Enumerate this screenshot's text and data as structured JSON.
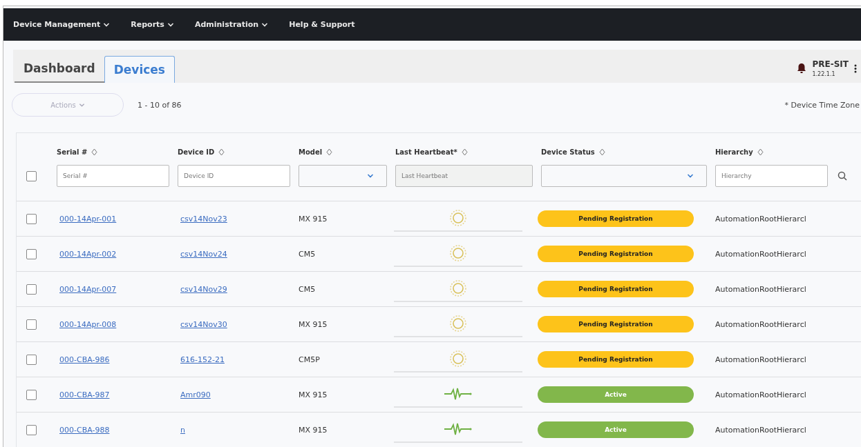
{
  "nav": [
    {
      "label": "Device Management",
      "dropdown": true
    },
    {
      "label": "Reports",
      "dropdown": true
    },
    {
      "label": "Administration",
      "dropdown": true
    },
    {
      "label": "Help & Support",
      "dropdown": false
    }
  ],
  "tabs": [
    {
      "label": "Dashboard",
      "selected": false
    },
    {
      "label": "Devices",
      "selected": true
    }
  ],
  "environment": {
    "name": "PRE-SIT",
    "version": "1.22.1.1"
  },
  "toolbar": {
    "actions": {
      "label": "Actions",
      "disabled": true
    },
    "range": "1 - 10 of 86",
    "note": "* Device Time Zone"
  },
  "table": {
    "select_all": {
      "checked": false
    },
    "columns": [
      {
        "label": "Serial #",
        "filter": {
          "kind": "text",
          "placeholder": "Serial #"
        }
      },
      {
        "label": "Device ID",
        "filter": {
          "kind": "text",
          "placeholder": "Device ID"
        }
      },
      {
        "label": "Model",
        "filter": {
          "kind": "select"
        }
      },
      {
        "label": "Last Heartbeat*",
        "filter": {
          "kind": "readonly",
          "placeholder": "Last Heartbeat"
        }
      },
      {
        "label": "Device Status",
        "filter": {
          "kind": "select"
        }
      },
      {
        "label": "Hierarchy",
        "filter": {
          "kind": "text",
          "placeholder": "Hierarchy"
        }
      }
    ],
    "rows": [
      {
        "checked": false,
        "serial": "000-14Apr-001",
        "device_id": "csv14Nov23",
        "model": "MX 915",
        "heartbeat": {
          "kind": "pending"
        },
        "status": {
          "label": "Pending Registration",
          "color": "#fdc31a"
        },
        "hierarchy": "AutomationRootHierarcl"
      },
      {
        "checked": false,
        "serial": "000-14Apr-002",
        "device_id": "csv14Nov24",
        "model": "CM5",
        "heartbeat": {
          "kind": "pending"
        },
        "status": {
          "label": "Pending Registration",
          "color": "#fdc31a"
        },
        "hierarchy": "AutomationRootHierarcl"
      },
      {
        "checked": false,
        "serial": "000-14Apr-007",
        "device_id": "csv14Nov29",
        "model": "CM5",
        "heartbeat": {
          "kind": "pending"
        },
        "status": {
          "label": "Pending Registration",
          "color": "#fdc31a"
        },
        "hierarchy": "AutomationRootHierarcl"
      },
      {
        "checked": false,
        "serial": "000-14Apr-008",
        "device_id": "csv14Nov30",
        "model": "MX 915",
        "heartbeat": {
          "kind": "pending"
        },
        "status": {
          "label": "Pending Registration",
          "color": "#fdc31a"
        },
        "hierarchy": "AutomationRootHierarcl"
      },
      {
        "checked": false,
        "serial": "000-CBA-986",
        "device_id": "616-152-21",
        "model": "CM5P",
        "heartbeat": {
          "kind": "pending"
        },
        "status": {
          "label": "Pending Registration",
          "color": "#fdc31a"
        },
        "hierarchy": "AutomationRootHierarcl"
      },
      {
        "checked": false,
        "serial": "000-CBA-987",
        "device_id": "Amr090",
        "model": "MX 915",
        "heartbeat": {
          "kind": "pulse"
        },
        "status": {
          "label": "Active",
          "color": "#82b74b"
        },
        "hierarchy": "AutomationRootHierarcl"
      },
      {
        "checked": false,
        "serial": "000-CBA-988",
        "device_id": "n",
        "model": "MX 915",
        "heartbeat": {
          "kind": "pulse"
        },
        "status": {
          "label": "Active",
          "color": "#82b74b"
        },
        "hierarchy": "AutomationRootHierarcl"
      }
    ]
  }
}
